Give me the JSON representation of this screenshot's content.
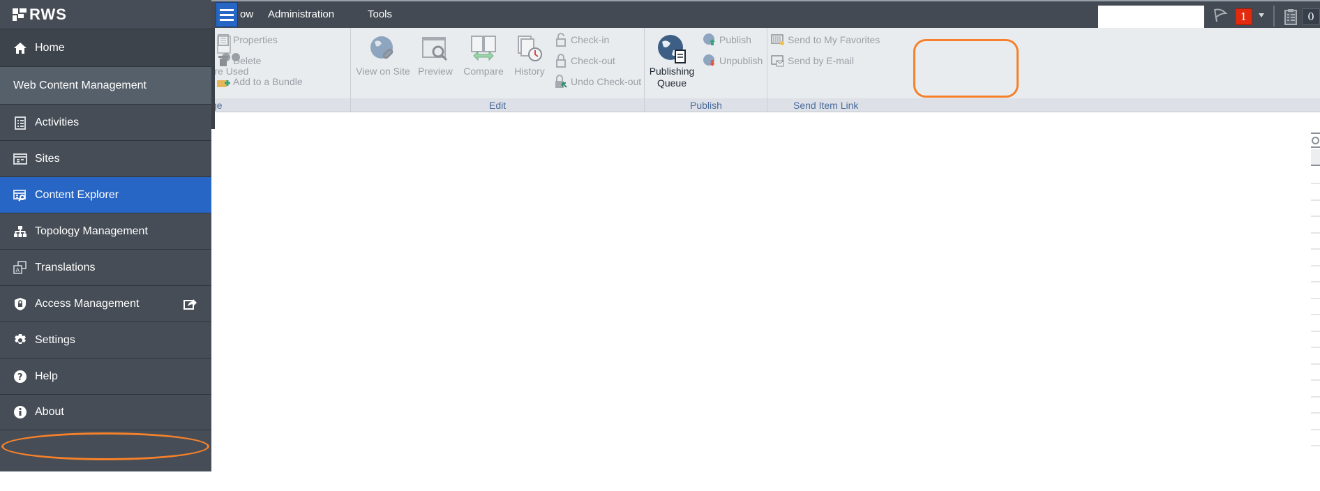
{
  "topbar": {
    "menus": [
      {
        "label": "ow"
      },
      {
        "label": "Administration"
      },
      {
        "label": "Tools"
      }
    ],
    "notification_count": "1",
    "activities_count": "0",
    "icons": {
      "menu": "hamburger-icon",
      "notifications": "flag-icon",
      "dropdown": "caret-down-icon",
      "activities": "clipboard-icon"
    }
  },
  "ribbon": {
    "groups": [
      {
        "label": "ge",
        "big_buttons": [
          {
            "label": "ere Used",
            "icon": "where-used-icon"
          }
        ],
        "small_buttons": [
          {
            "label": "Properties",
            "icon": "properties-icon"
          },
          {
            "label": "Delete",
            "icon": "trash-icon"
          },
          {
            "label": "Add to a Bundle",
            "icon": "add-to-bundle-icon"
          }
        ]
      },
      {
        "label": "Edit",
        "big_buttons": [
          {
            "label": "View on Site",
            "icon": "globe-link-icon"
          },
          {
            "label": "Preview",
            "icon": "preview-icon"
          },
          {
            "label": "Compare",
            "icon": "compare-icon"
          },
          {
            "label": "History",
            "icon": "history-icon"
          }
        ],
        "small_buttons": [
          {
            "label": "Check-in",
            "icon": "unlock-icon"
          },
          {
            "label": "Check-out",
            "icon": "lock-icon"
          },
          {
            "label": "Undo Check-out",
            "icon": "undo-checkout-icon"
          }
        ]
      },
      {
        "label": "Publish",
        "big_buttons": [
          {
            "label_line1": "Publishing",
            "label_line2": "Queue",
            "icon": "publishing-queue-icon"
          }
        ],
        "small_buttons": [
          {
            "label": "Publish",
            "icon": "publish-icon"
          },
          {
            "label": "Unpublish",
            "icon": "unpublish-icon"
          }
        ]
      },
      {
        "label": "Send Item Link",
        "small_buttons": [
          {
            "label": "Send to My Favorites",
            "icon": "favorites-icon"
          },
          {
            "label": "Send by E-mail",
            "icon": "email-icon"
          }
        ]
      }
    ]
  },
  "sidebar": {
    "logo": "RWS",
    "items": [
      {
        "label": "Home",
        "icon": "home-icon"
      },
      {
        "label": "Web Content Management",
        "section": true
      },
      {
        "label": "Activities",
        "icon": "activities-icon"
      },
      {
        "label": "Sites",
        "icon": "sites-icon"
      },
      {
        "label": "Content Explorer",
        "icon": "content-explorer-icon",
        "selected": true
      },
      {
        "label": "Topology Management",
        "icon": "topology-icon"
      },
      {
        "label": "Translations",
        "icon": "translations-icon"
      },
      {
        "label": "Access Management",
        "icon": "shield-icon",
        "external": true
      },
      {
        "label": "Settings",
        "icon": "gear-icon"
      },
      {
        "label": "Help",
        "icon": "help-icon"
      },
      {
        "label": "About",
        "icon": "info-icon"
      }
    ]
  },
  "annotations": {
    "highlight_color": "#f6812a"
  },
  "colors": {
    "sidebar_bg": "#464d56",
    "selected": "#2866c6",
    "badge_red": "#e22a0f"
  }
}
